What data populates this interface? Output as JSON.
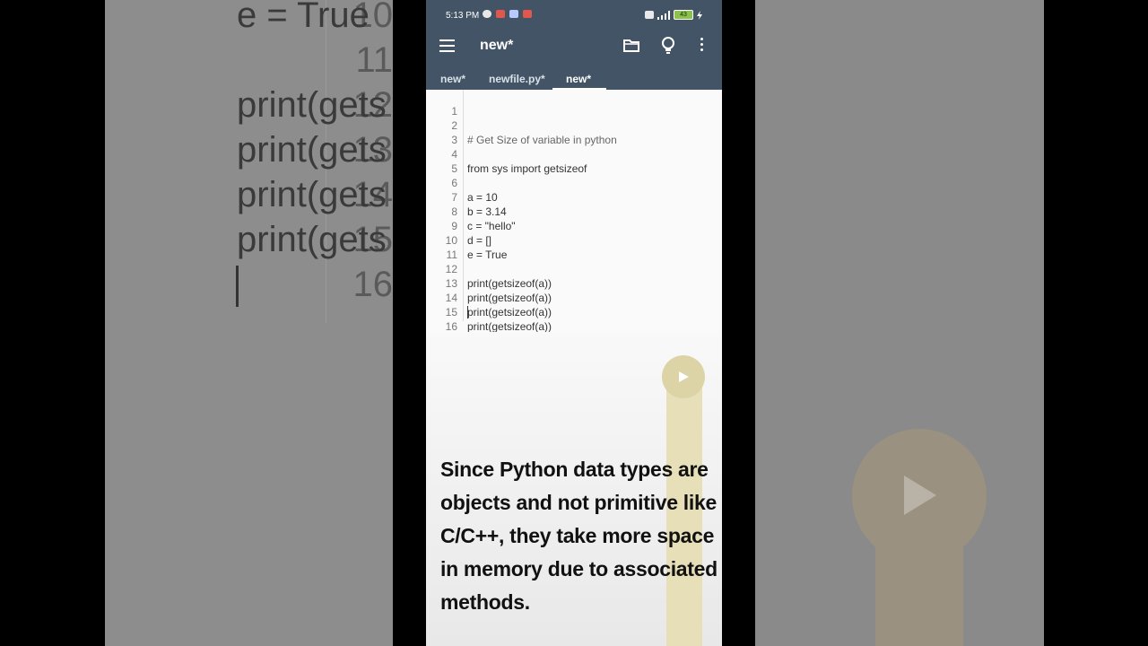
{
  "background": {
    "lines": [
      {
        "num": "10",
        "text": "e = True"
      },
      {
        "num": "11",
        "text": ""
      },
      {
        "num": "12",
        "text": "print(gets"
      },
      {
        "num": "13",
        "text": "print(gets"
      },
      {
        "num": "14",
        "text": "print(gets"
      },
      {
        "num": "15",
        "text": "print(gets"
      },
      {
        "num": "16",
        "text": ""
      }
    ]
  },
  "status_bar": {
    "time": "5:13 PM",
    "battery": "43"
  },
  "app": {
    "title": "new*"
  },
  "tabs": [
    {
      "label": "new*"
    },
    {
      "label": "newfile.py*"
    },
    {
      "label": "new*",
      "active": true
    }
  ],
  "editor": {
    "lines": [
      {
        "num": "1",
        "text": ""
      },
      {
        "num": "2",
        "text": "# Get Size of variable in python"
      },
      {
        "num": "3",
        "text": ""
      },
      {
        "num": "4",
        "text": "from sys import getsizeof"
      },
      {
        "num": "5",
        "text": ""
      },
      {
        "num": "6",
        "text": "a = 10"
      },
      {
        "num": "7",
        "text": "b = 3.14"
      },
      {
        "num": "8",
        "text": "c = \"hello\""
      },
      {
        "num": "9",
        "text": "d = []"
      },
      {
        "num": "10",
        "text": "e = True"
      },
      {
        "num": "11",
        "text": ""
      },
      {
        "num": "12",
        "text": "print(getsizeof(a))"
      },
      {
        "num": "13",
        "text": "print(getsizeof(a))"
      },
      {
        "num": "14",
        "text": "print(getsizeof(a))"
      },
      {
        "num": "15",
        "text": "print(getsizeof(a))"
      },
      {
        "num": "16",
        "text": ""
      }
    ]
  },
  "caption": "Since Python data types are objects and not primitive like C/C++, they take more space in memory due to associated methods."
}
